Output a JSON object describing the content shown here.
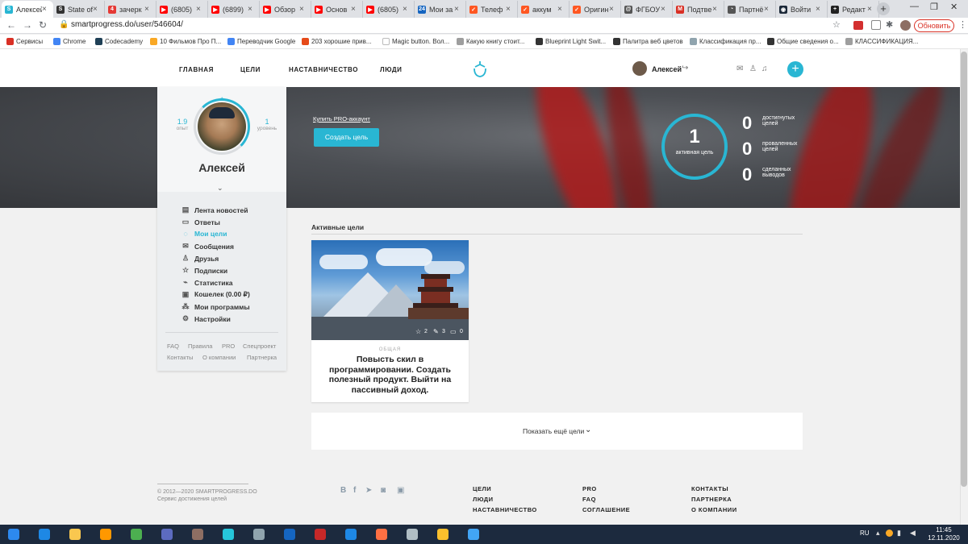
{
  "browser": {
    "tabs": [
      {
        "title": "Алексей",
        "color": "#29b6d3",
        "glyph": "S"
      },
      {
        "title": "State of",
        "color": "#333333",
        "glyph": "S"
      },
      {
        "title": "зачерк",
        "color": "#e53935",
        "glyph": "4"
      },
      {
        "title": "(6805)",
        "color": "#ff0000",
        "glyph": "▶"
      },
      {
        "title": "(6899)",
        "color": "#ff0000",
        "glyph": "▶"
      },
      {
        "title": "Обзор",
        "color": "#ff0000",
        "glyph": "▶"
      },
      {
        "title": "Основ",
        "color": "#ff0000",
        "glyph": "▶"
      },
      {
        "title": "(6805)",
        "color": "#ff0000",
        "glyph": "▶"
      },
      {
        "title": "Мои за",
        "color": "#1565c0",
        "glyph": "24"
      },
      {
        "title": "Телеф",
        "color": "#ff5722",
        "glyph": "✓"
      },
      {
        "title": "аккум",
        "color": "#ff5722",
        "glyph": "✓"
      },
      {
        "title": "Оригин",
        "color": "#ff5722",
        "glyph": "✓"
      },
      {
        "title": "ФГБОУ",
        "color": "#555555",
        "glyph": "@"
      },
      {
        "title": "Подтве",
        "color": "#d93025",
        "glyph": "M"
      },
      {
        "title": "Партнё",
        "color": "#555555",
        "glyph": "◔"
      },
      {
        "title": "Войти",
        "color": "#1b2838",
        "glyph": "◉"
      },
      {
        "title": "Редакт",
        "color": "#222222",
        "glyph": "+"
      }
    ],
    "url": "smartprogress.do/user/546604/",
    "refresh_label": "Обновить",
    "bookmarks": [
      {
        "label": "Сервисы",
        "color": "#d93025"
      },
      {
        "label": "Chrome",
        "color": "#4285f4"
      },
      {
        "label": "Codecademy",
        "color": "#1f4056"
      },
      {
        "label": "10 Фильмов Про П...",
        "color": "#f9a825"
      },
      {
        "label": "Переводчик Google",
        "color": "#4285f4"
      },
      {
        "label": "203 хорошие прив...",
        "color": "#e64a19"
      },
      {
        "label": "Magic button. Вол...",
        "color": "#ffffff"
      },
      {
        "label": "Какую книгу стоит...",
        "color": "#9e9e9e"
      },
      {
        "label": "Blueprint Light Swit...",
        "color": "#333333"
      },
      {
        "label": "Палитра веб цветов",
        "color": "#333333"
      },
      {
        "label": "Классификация пр...",
        "color": "#90a4ae"
      },
      {
        "label": "Общие сведения о...",
        "color": "#333333"
      },
      {
        "label": "КЛАССИФИКАЦИЯ...",
        "color": "#9e9e9e"
      }
    ]
  },
  "site": {
    "nav": [
      "ГЛАВНАЯ",
      "ЦЕЛИ",
      "НАСТАВНИЧЕСТВО",
      "ЛЮДИ"
    ],
    "user_name": "Алексей",
    "accent": "#29b6d3"
  },
  "profile": {
    "experience_value": "1.9",
    "experience_label": "опыт",
    "level_value": "1",
    "level_label": "уровень",
    "name": "Алексей",
    "menu": [
      {
        "label": "Лента новостей",
        "icon": "news-icon",
        "glyph": "▤",
        "active": false
      },
      {
        "label": "Ответы",
        "icon": "comment-icon",
        "glyph": "▭",
        "active": false
      },
      {
        "label": "Мои цели",
        "icon": "target-icon",
        "glyph": "◌",
        "active": true
      },
      {
        "label": "Сообщения",
        "icon": "envelope-icon",
        "glyph": "✉",
        "active": false
      },
      {
        "label": "Друзья",
        "icon": "person-icon",
        "glyph": "♙",
        "active": false
      },
      {
        "label": "Подписки",
        "icon": "star-icon",
        "glyph": "☆",
        "active": false
      },
      {
        "label": "Статистика",
        "icon": "chart-line-icon",
        "glyph": "⌁",
        "active": false
      },
      {
        "label": "Кошелек (0.00 ₽)",
        "icon": "wallet-icon",
        "glyph": "▣",
        "active": false
      },
      {
        "label": "Мои программы",
        "icon": "programs-icon",
        "glyph": "⁂",
        "active": false
      },
      {
        "label": "Настройки",
        "icon": "gear-icon",
        "glyph": "⚙",
        "active": false
      }
    ],
    "footer_links_row1": [
      "FAQ",
      "Правила",
      "PRO",
      "Спецпроект"
    ],
    "footer_links_row2": [
      "Контакты",
      "О компании",
      "Партнерка"
    ]
  },
  "hero": {
    "pro_link": "Купить PRO-аккаунт",
    "create_button": "Создать цель",
    "active_count": "1",
    "active_label": "активная цель",
    "stats": [
      {
        "value": "0",
        "label": "достигнутых целей"
      },
      {
        "value": "0",
        "label": "проваленных целей"
      },
      {
        "value": "0",
        "label": "сделанных выводов"
      }
    ]
  },
  "goals": {
    "section_title": "Активные цели",
    "card": {
      "likes": "2",
      "edits": "3",
      "comments": "0",
      "category": "ОБЩАЯ",
      "title": "Повысть скил в программировании. Создать полезный продукт. Выйти на пассивный доход."
    },
    "show_more": "Показать ещё цели"
  },
  "footer": {
    "copyright": "© 2012—2020 SMARTPROGRESS.DO",
    "tagline": "Сервис достижения целей",
    "col1": [
      "ЦЕЛИ",
      "ЛЮДИ",
      "НАСТАВНИЧЕСТВО"
    ],
    "col2": [
      "PRO",
      "FAQ",
      "СОГЛАШЕНИЕ"
    ],
    "col3": [
      "КОНТАКТЫ",
      "ПАРТНЕРКА",
      "О КОМПАНИИ"
    ]
  },
  "taskbar": {
    "lang": "RU",
    "time": "11:45",
    "date": "12.11.2020",
    "apps": [
      {
        "name": "start-button",
        "color": "#2d89ef"
      },
      {
        "name": "ie-icon",
        "color": "#1e88e5"
      },
      {
        "name": "explorer-icon",
        "color": "#f9c74f"
      },
      {
        "name": "sublime-icon",
        "color": "#ff9800"
      },
      {
        "name": "chrome-icon",
        "color": "#4caf50"
      },
      {
        "name": "app-icon",
        "color": "#5c6bc0"
      },
      {
        "name": "game-icon",
        "color": "#8d6e63"
      },
      {
        "name": "edge-icon",
        "color": "#26c6da"
      },
      {
        "name": "network-icon",
        "color": "#90a4ae"
      },
      {
        "name": "steam-icon",
        "color": "#1565c0"
      },
      {
        "name": "filezilla-icon",
        "color": "#c62828"
      },
      {
        "name": "vscode-icon",
        "color": "#1e88e5"
      },
      {
        "name": "firefox-icon",
        "color": "#ff7043"
      },
      {
        "name": "notepad-icon",
        "color": "#b0bec5"
      },
      {
        "name": "mail-icon",
        "color": "#fbc02d"
      },
      {
        "name": "remote-icon",
        "color": "#42a5f5"
      }
    ]
  }
}
